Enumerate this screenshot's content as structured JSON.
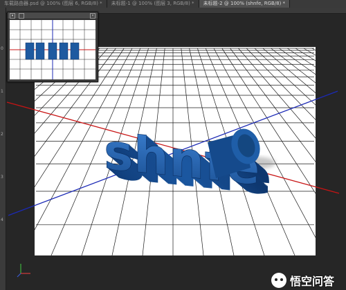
{
  "tabs": [
    {
      "label": "车载路由器.psd @ 100% (图层 6, RGB/8) *",
      "active": false
    },
    {
      "label": "未标题-1 @ 100% (图层 3, RGB/8) *",
      "active": false
    },
    {
      "label": "未标题-2 @ 100% (shnfe, RGB/8) *",
      "active": true
    }
  ],
  "ruler_labels": [
    "0",
    "1",
    "2",
    "3",
    "4"
  ],
  "extruded_text": "shnfe",
  "navigator": {
    "close_label": "×",
    "collapse_label": "▾"
  },
  "watermark": {
    "text": "悟空问答"
  },
  "colors": {
    "text_blue": "#1e5aa0",
    "axis_x": "#cc1111",
    "axis_z": "#1d2bb8",
    "grid": "#222222",
    "canvas": "#ffffff"
  }
}
